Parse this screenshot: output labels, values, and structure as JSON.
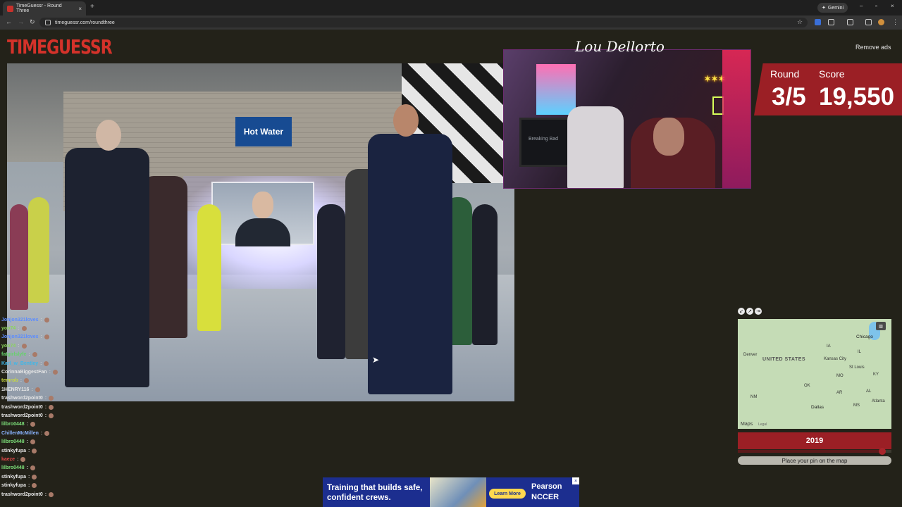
{
  "browser": {
    "tab_title": "TimeGuessr - Round Three",
    "tab_close": "×",
    "new_tab": "+",
    "url": "timeguessr.com/roundthree",
    "gemini_label": "Gemini",
    "window_controls": [
      "–",
      "▫",
      "×"
    ],
    "nav_icons": [
      "back-icon",
      "forward-icon",
      "reload-icon",
      "site-info-icon",
      "star-icon",
      "extensions-icon",
      "profile-icon",
      "menu-icon"
    ]
  },
  "site": {
    "logo": "TIMEGUESSR",
    "remove_ads": "Remove ads"
  },
  "photo": {
    "sign_text": "Hot Water"
  },
  "webcam": {
    "signature": "Lou Dellorto",
    "tv_text": "Breaking Bad"
  },
  "score": {
    "round_label": "Round",
    "score_label": "Score",
    "round_value": "3/5",
    "score_value": "19,550"
  },
  "chat": [
    {
      "user": "Jonjon321loves",
      "color": "#5b8cff"
    },
    {
      "user": "yoo74",
      "color": "#8bd65c"
    },
    {
      "user": "Jonjon321loves",
      "color": "#5b8cff"
    },
    {
      "user": "yoo74",
      "color": "#8bd65c"
    },
    {
      "user": "fatgirlslyfe",
      "color": "#67d26c"
    },
    {
      "user": "Karl_w_Bentley",
      "color": "#3fb6e8"
    },
    {
      "user": "CorinnaBiggestFan",
      "color": "#e6e6e6"
    },
    {
      "user": "temrob",
      "color": "#c9d940"
    },
    {
      "user": "1HENRY116",
      "color": "#e6e6e6"
    },
    {
      "user": "trashword2point0",
      "color": "#e6e6e6"
    },
    {
      "user": "trashword2point0",
      "color": "#e6e6e6"
    },
    {
      "user": "trashword2point0",
      "color": "#e6e6e6"
    },
    {
      "user": "lilbro0448",
      "color": "#7de07a"
    },
    {
      "user": "ChillenMcMillen",
      "color": "#8ab4ff"
    },
    {
      "user": "lilbro0448",
      "color": "#7de07a"
    },
    {
      "user": "stinkyfupa",
      "color": "#e6e6e6"
    },
    {
      "user": "kaeze",
      "color": "#e34a4a"
    },
    {
      "user": "lilbro0448",
      "color": "#7de07a"
    },
    {
      "user": "stinkyfupa",
      "color": "#e6e6e6"
    },
    {
      "user": "stinkyfupa",
      "color": "#e6e6e6"
    },
    {
      "user": "trashword2point0",
      "color": "#e6e6e6"
    }
  ],
  "map": {
    "country": "UNITED STATES",
    "cities": [
      "Chicago",
      "Denver",
      "Kansas City",
      "St Louis",
      "OK",
      "Dallas",
      "Atlanta",
      "NM",
      "MO",
      "AR",
      "MS",
      "AL",
      "KY",
      "IL",
      "IA"
    ],
    "attribution": "Maps",
    "legal": "Legal",
    "toggle": "▥"
  },
  "year": {
    "value": "2019",
    "slider_position": 0.94
  },
  "place_pin": "Place your pin on the map",
  "ad": {
    "headline": "Training that builds safe, confident crews.",
    "button": "Learn More",
    "brand": "Pearson NCCER",
    "close": "×",
    "brand_color": "#1c2e8f"
  },
  "colors": {
    "accent": "#9b1f25",
    "logo": "#d4322a",
    "page_bg": "#232219"
  }
}
